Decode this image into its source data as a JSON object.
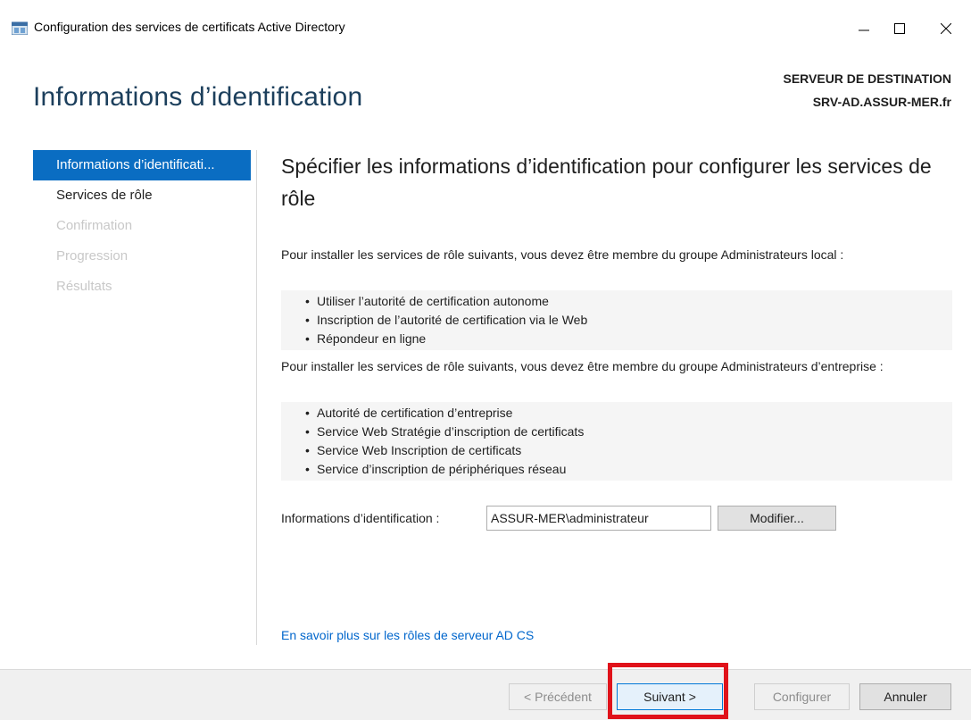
{
  "window": {
    "title": "Configuration des services de certificats Active Directory",
    "minimize_glyph": "—",
    "maximize_glyph": "☐",
    "close_glyph": "✕"
  },
  "header": {
    "title": "Informations d’identification",
    "destination_label": "SERVEUR DE DESTINATION",
    "destination_server": "SRV-AD.ASSUR-MER.fr"
  },
  "nav": {
    "items": [
      {
        "label": "Informations d’identificati...",
        "state": "active"
      },
      {
        "label": "Services de rôle",
        "state": "enabled"
      },
      {
        "label": "Confirmation",
        "state": "disabled"
      },
      {
        "label": "Progression",
        "state": "disabled"
      },
      {
        "label": "Résultats",
        "state": "disabled"
      }
    ]
  },
  "content": {
    "heading": "Spécifier les informations d’identification pour configurer les services de rôle",
    "local_intro": "Pour installer les services de rôle suivants, vous devez être membre du groupe Administrateurs local :",
    "local_roles": [
      "Utiliser l’autorité de certification autonome",
      "Inscription de l’autorité de certification via le Web",
      "Répondeur en ligne"
    ],
    "enterprise_intro": "Pour installer les services de rôle suivants, vous devez être membre du groupe Administrateurs d’entreprise :",
    "enterprise_roles": [
      "Autorité de certification d’entreprise",
      "Service Web Stratégie d’inscription de certificats",
      "Service Web Inscription de certificats",
      "Service d’inscription de périphériques réseau"
    ],
    "credentials_label": "Informations d’identification :",
    "credentials_value": "ASSUR-MER\\administrateur",
    "modify_label": "Modifier..."
  },
  "learn_more": "En savoir plus sur les rôles de serveur AD CS",
  "footer": {
    "previous_label": "< Précédent",
    "next_label": "Suivant >",
    "configure_label": "Configurer",
    "cancel_label": "Annuler"
  },
  "colors": {
    "accent": "#0a6dc2",
    "highlight": "#e0121a",
    "link": "#0066cc"
  },
  "icons": {
    "app": "server-manager-icon"
  }
}
